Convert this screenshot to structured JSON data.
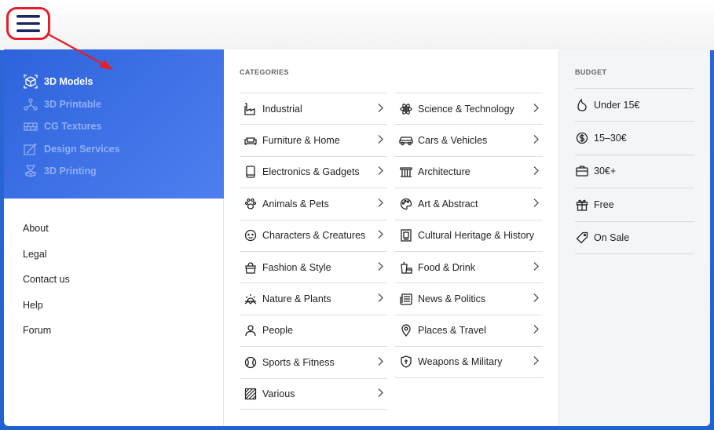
{
  "header": {
    "menu_icon": "hamburger-menu-icon",
    "highlight_color": "#e2202c"
  },
  "colors": {
    "accent": "#2e63dc",
    "panel_bg": "#ffffff",
    "budget_bg": "#f4f5f7"
  },
  "sections": [
    {
      "label": "3D Models",
      "icon": "cube-icon",
      "active": true
    },
    {
      "label": "3D Printable",
      "icon": "molecule-icon",
      "active": false
    },
    {
      "label": "CG Textures",
      "icon": "bricks-icon",
      "active": false
    },
    {
      "label": "Design Services",
      "icon": "design-tools-icon",
      "active": false
    },
    {
      "label": "3D Printing",
      "icon": "printer-nozzle-icon",
      "active": false
    }
  ],
  "links": [
    "About",
    "Legal",
    "Contact us",
    "Help",
    "Forum"
  ],
  "categories": {
    "heading": "CATEGORIES",
    "left": [
      {
        "label": "Industrial",
        "icon": "factory-icon",
        "chevron": true
      },
      {
        "label": "Furniture & Home",
        "icon": "sofa-icon",
        "chevron": true
      },
      {
        "label": "Electronics & Gadgets",
        "icon": "phone-icon",
        "chevron": true
      },
      {
        "label": "Animals & Pets",
        "icon": "paw-icon",
        "chevron": true
      },
      {
        "label": "Characters & Creatures",
        "icon": "face-icon",
        "chevron": true
      },
      {
        "label": "Fashion & Style",
        "icon": "handbag-icon",
        "chevron": true
      },
      {
        "label": "Nature & Plants",
        "icon": "sun-landscape-icon",
        "chevron": true
      },
      {
        "label": "People",
        "icon": "person-icon",
        "chevron": false
      },
      {
        "label": "Sports & Fitness",
        "icon": "ball-icon",
        "chevron": true
      },
      {
        "label": "Various",
        "icon": "hatched-square-icon",
        "chevron": true
      }
    ],
    "right": [
      {
        "label": "Science & Technology",
        "icon": "atom-icon",
        "chevron": true
      },
      {
        "label": "Cars & Vehicles",
        "icon": "car-icon",
        "chevron": true
      },
      {
        "label": "Architecture",
        "icon": "columns-icon",
        "chevron": true
      },
      {
        "label": "Art & Abstract",
        "icon": "palette-icon",
        "chevron": true
      },
      {
        "label": "Cultural Heritage & History",
        "icon": "scroll-icon",
        "chevron": false
      },
      {
        "label": "Food & Drink",
        "icon": "cup-cake-icon",
        "chevron": true
      },
      {
        "label": "News & Politics",
        "icon": "newspaper-icon",
        "chevron": true
      },
      {
        "label": "Places & Travel",
        "icon": "map-pin-icon",
        "chevron": true
      },
      {
        "label": "Weapons & Military",
        "icon": "shield-icon",
        "chevron": true
      }
    ]
  },
  "budget": {
    "heading": "BUDGET",
    "items": [
      {
        "label": "Under 15€",
        "icon": "flame-icon"
      },
      {
        "label": "15–30€",
        "icon": "dollar-circle-icon"
      },
      {
        "label": "30€+",
        "icon": "briefcase-icon"
      },
      {
        "label": "Free",
        "icon": "gift-icon"
      },
      {
        "label": "On Sale",
        "icon": "tag-icon"
      }
    ]
  }
}
